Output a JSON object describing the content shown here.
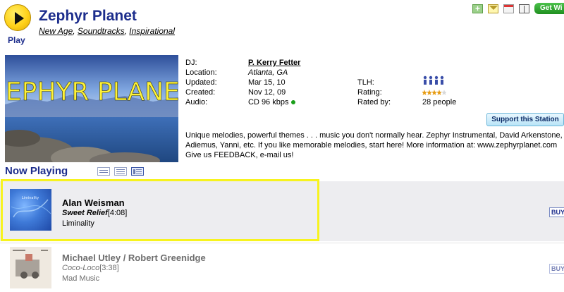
{
  "header": {
    "play_label": "Play",
    "station_name": "Zephyr Planet",
    "genres": [
      "New Age",
      "Soundtracks",
      "Inspirational"
    ],
    "get_widget_label": "Get Wi"
  },
  "station": {
    "art_text": "ZEPHYR PLANET",
    "info": {
      "dj_label": "DJ:",
      "dj_value": "P. Kerry Fetter",
      "location_label": "Location:",
      "location_value": "Atlanta, GA",
      "updated_label": "Updated:",
      "updated_value": "Mar 15, 10",
      "created_label": "Created:",
      "created_value": "Nov 12, 09",
      "audio_label": "Audio:",
      "audio_value": "CD 96 kbps",
      "tlh_label": "TLH:",
      "rating_label": "Rating:",
      "rating_stars": 4,
      "rated_by_label": "Rated by:",
      "rated_by_value": "28 people"
    },
    "support_button": "Support this Station",
    "description": "Unique melodies, powerful themes . . . music you don't normally hear. Zephyr Instrumental, David Arkenstone, Adiemus, Yanni, etc. If you like memorable melodies, start here! More information at: www.zephyrplanet.com Give us FEEDBACK, e-mail us!"
  },
  "now_playing": {
    "title": "Now Playing",
    "tracks": [
      {
        "artist": "Alan Weisman",
        "song": "Sweet Relief",
        "duration": "[4:08]",
        "album": "Liminality",
        "album_art_text": "Liminality",
        "buy_label": "BUY"
      },
      {
        "artist": "Michael Utley / Robert Greenidge",
        "song": "Coco-Loco",
        "duration": "[3:38]",
        "album": "Mad Music",
        "buy_label": "BUY"
      }
    ]
  },
  "colors": {
    "brand_blue": "#1c2d8c",
    "highlight": "#f7f31e",
    "play_yellow": "#ffd21a",
    "widget_green": "#2ea82e",
    "status_green": "#1a9e1a"
  },
  "icons": [
    "play-icon",
    "add-icon",
    "mail-icon",
    "calendar-icon",
    "book-icon",
    "list-view-icon",
    "compact-view-icon",
    "detail-view-icon",
    "listener-icon",
    "star-icon",
    "status-dot-icon"
  ]
}
